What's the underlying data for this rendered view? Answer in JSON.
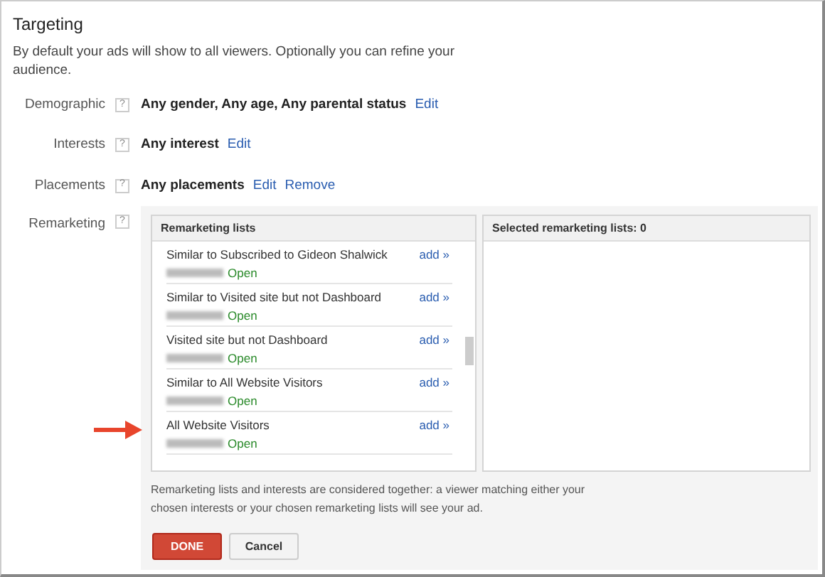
{
  "title": "Targeting",
  "description": "By default your ads will show to all viewers. Optionally you can refine your audience.",
  "settings": [
    {
      "label": "Demographic",
      "help": "?",
      "value": "Any gender, Any age, Any parental status",
      "links": [
        "Edit"
      ]
    },
    {
      "label": "Interests",
      "help": "?",
      "value": "Any interest",
      "links": [
        "Edit"
      ]
    },
    {
      "label": "Placements",
      "help": "?",
      "value": "Any placements",
      "links": [
        "Edit",
        "Remove"
      ]
    }
  ],
  "remarketing": {
    "label": "Remarketing",
    "help": "?",
    "lists_header": "Remarketing lists",
    "lists": [
      {
        "name": "Similar to Subscribed to Gideon Shalwick",
        "status": "Open",
        "action": "add »"
      },
      {
        "name": "Similar to Visited site but not Dashboard",
        "status": "Open",
        "action": "add »"
      },
      {
        "name": "Visited site but not Dashboard",
        "status": "Open",
        "action": "add »"
      },
      {
        "name": "Similar to All Website Visitors",
        "status": "Open",
        "action": "add »"
      },
      {
        "name": "All Website Visitors",
        "status": "Open",
        "action": "add »"
      }
    ],
    "selected_header": "Selected remarketing lists: 0",
    "note": "Remarketing lists and interests are considered together: a viewer matching either your chosen interests or your chosen remarketing lists will see your ad.",
    "buttons": [
      {
        "label": "DONE",
        "kind": "primary"
      },
      {
        "label": "Cancel",
        "kind": "secondary"
      }
    ]
  }
}
